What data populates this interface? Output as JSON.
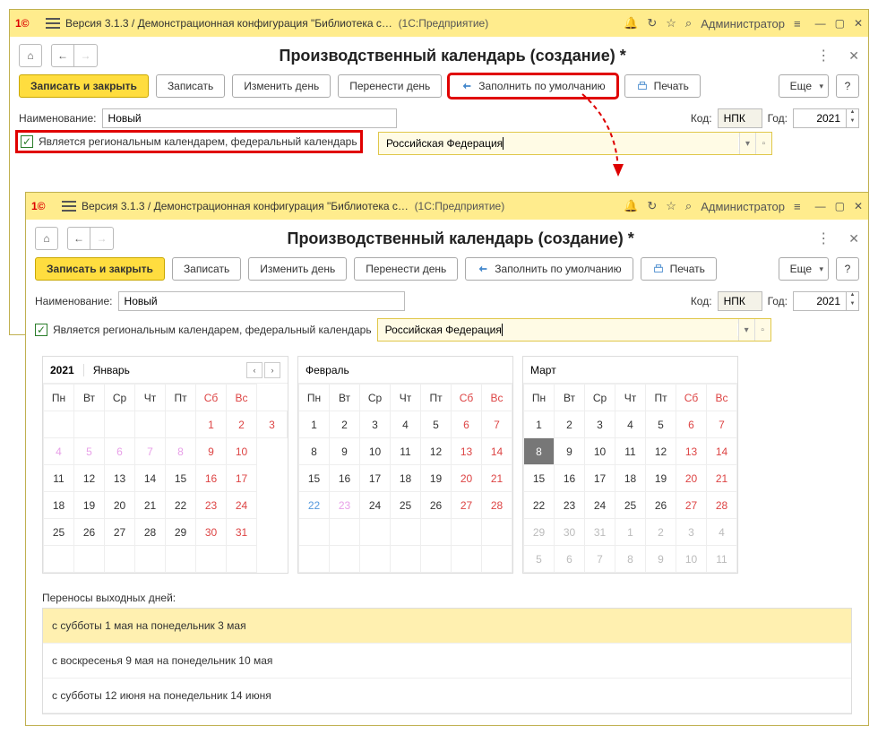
{
  "titlebar": {
    "version": "Версия 3.1.3 / Демонстрационная конфигурация \"Библиотека с…",
    "product": "(1С:Предприятие)",
    "user": "Администратор"
  },
  "header": {
    "title": "Производственный календарь (создание) *"
  },
  "toolbar": {
    "save_close": "Записать и закрыть",
    "save": "Записать",
    "change_day": "Изменить день",
    "move_day": "Перенести день",
    "fill_default": "Заполнить по умолчанию",
    "print": "Печать",
    "more": "Еще",
    "help": "?"
  },
  "form": {
    "name_label": "Наименование:",
    "name_value": "Новый",
    "code_label": "Код:",
    "code_value": "НПК",
    "year_label": "Год:",
    "year_value": "2021",
    "checkbox_label": "Является региональным календарем, федеральный календарь",
    "federal_value": "Российская Федерация"
  },
  "calendar": {
    "year": "2021",
    "months": [
      "Январь",
      "Февраль",
      "Март"
    ],
    "days": [
      "Пн",
      "Вт",
      "Ср",
      "Чт",
      "Пт",
      "Сб",
      "Вс"
    ],
    "jan": [
      [
        "",
        "",
        "",
        "",
        "",
        "1",
        "2",
        "3"
      ],
      [
        "4",
        "5",
        "6",
        "7",
        "8",
        "9",
        "10"
      ],
      [
        "11",
        "12",
        "13",
        "14",
        "15",
        "16",
        "17"
      ],
      [
        "18",
        "19",
        "20",
        "21",
        "22",
        "23",
        "24"
      ],
      [
        "25",
        "26",
        "27",
        "28",
        "29",
        "30",
        "31"
      ],
      [
        "",
        "",
        "",
        "",
        "",
        "",
        ""
      ]
    ],
    "feb": [
      [
        "1",
        "2",
        "3",
        "4",
        "5",
        "6",
        "7"
      ],
      [
        "8",
        "9",
        "10",
        "11",
        "12",
        "13",
        "14"
      ],
      [
        "15",
        "16",
        "17",
        "18",
        "19",
        "20",
        "21"
      ],
      [
        "22",
        "23",
        "24",
        "25",
        "26",
        "27",
        "28"
      ],
      [
        "",
        "",
        "",
        "",
        "",
        "",
        ""
      ],
      [
        "",
        "",
        "",
        "",
        "",
        "",
        ""
      ]
    ],
    "mar": [
      [
        "1",
        "2",
        "3",
        "4",
        "5",
        "6",
        "7"
      ],
      [
        "8",
        "9",
        "10",
        "11",
        "12",
        "13",
        "14"
      ],
      [
        "15",
        "16",
        "17",
        "18",
        "19",
        "20",
        "21"
      ],
      [
        "22",
        "23",
        "24",
        "25",
        "26",
        "27",
        "28"
      ],
      [
        "29",
        "30",
        "31",
        "1",
        "2",
        "3",
        "4"
      ],
      [
        "5",
        "6",
        "7",
        "8",
        "9",
        "10",
        "11"
      ]
    ]
  },
  "transfers": {
    "title": "Переносы выходных дней:",
    "items": [
      "с субботы 1 мая на понедельник 3 мая",
      "с воскресенья 9 мая на понедельник 10 мая",
      "с субботы 12 июня на понедельник 14 июня"
    ]
  }
}
